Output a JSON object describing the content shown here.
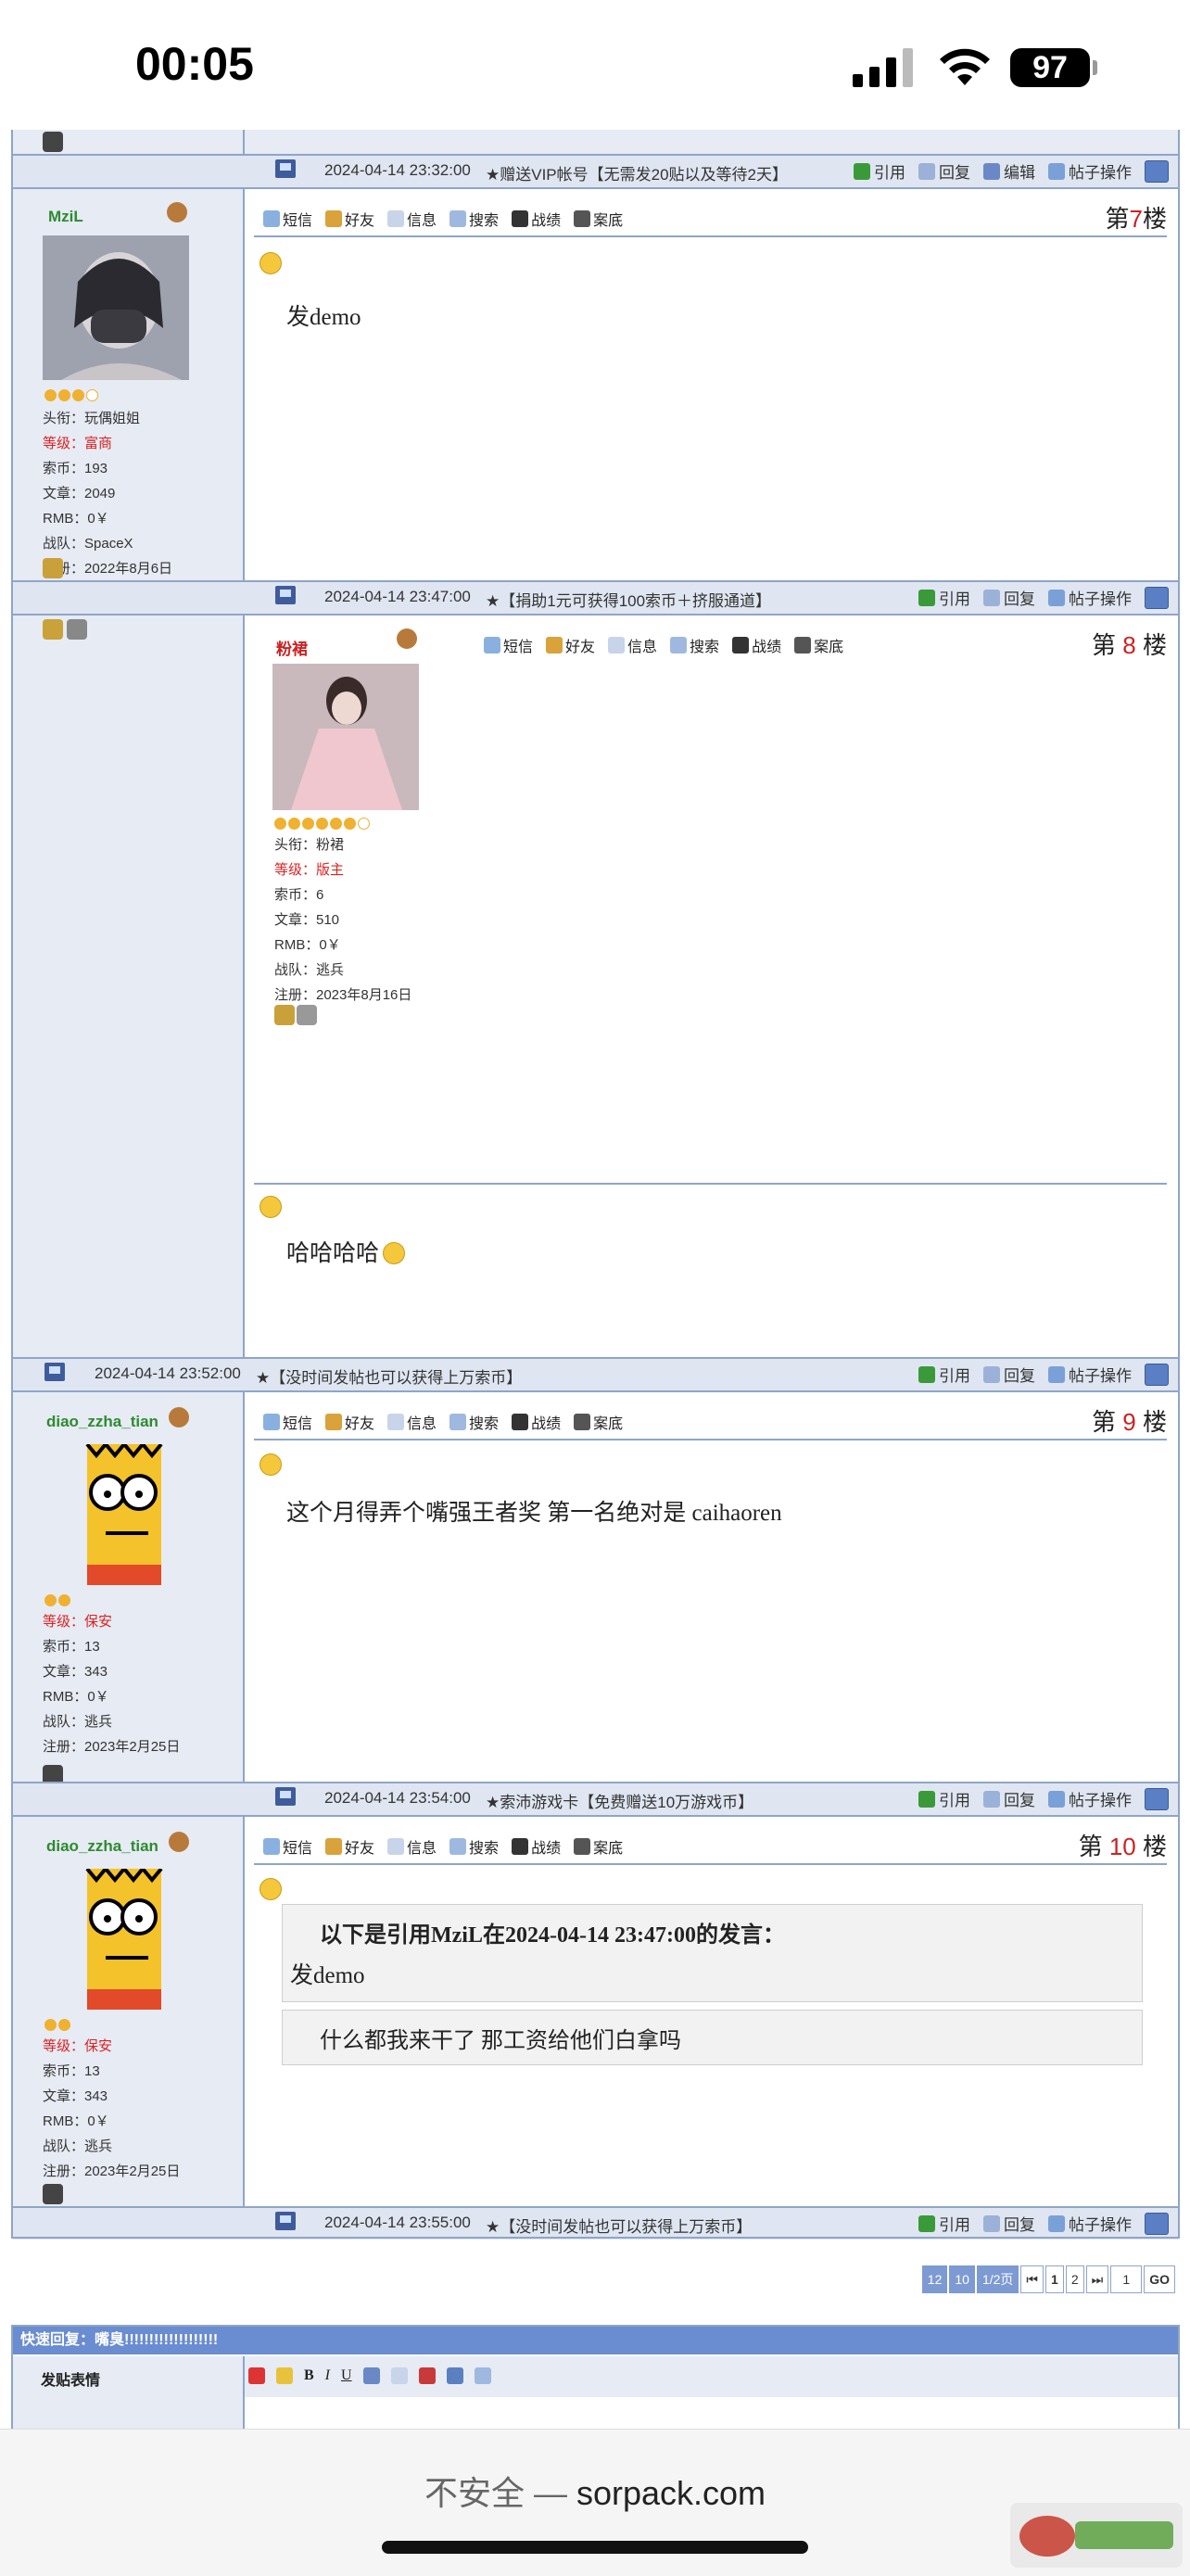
{
  "status": {
    "time": "00:05",
    "battery": "97"
  },
  "ui": {
    "top_bar_date": "2024-04-14 23:32:00",
    "top_bar_ann": "★赠送VIP帐号【无需发20贴以及等待2天】",
    "acts": {
      "quote": "引用",
      "reply": "回复",
      "edit": "编辑",
      "op": "帖子操作"
    },
    "toolbar": {
      "sms": "短信",
      "friend": "好友",
      "info": "信息",
      "search": "搜索",
      "record": "战绩",
      "case": "案底"
    },
    "floor_prefix": "第",
    "floor_suffix": "楼"
  },
  "posts": [
    {
      "floor": "7",
      "user": "MziL",
      "title": "头衔：玩偶姐姐",
      "level": "等级：富商",
      "coins": "索币：193",
      "articles": "文章：2049",
      "rmb": "RMB：0￥",
      "team": "战队：SpaceX",
      "reg": "注册：2022年8月6日",
      "msg": "发demo",
      "bar_date": "2024-04-14 23:47:00",
      "bar_ann": "★【捐助1元可获得100索币＋挤服通道】"
    },
    {
      "floor": "8",
      "user": "粉裙",
      "title": "头衔：粉裙",
      "level": "等级：版主",
      "coins": "索币：6",
      "articles": "文章：510",
      "rmb": "RMB：0￥",
      "team": "战队：逃兵",
      "reg": "注册：2023年8月16日",
      "msg": "哈哈哈哈",
      "bar_date": "2024-04-14 23:52:00",
      "bar_ann": "★【没时间发帖也可以获得上万索币】"
    },
    {
      "floor": "9",
      "user": "diao_zzha_tian",
      "level": "等级：保安",
      "coins": "索币：13",
      "articles": "文章：343",
      "rmb": "RMB：0￥",
      "team": "战队：逃兵",
      "reg": "注册：2023年2月25日",
      "msg": "这个月得弄个嘴强王者奖 第一名绝对是 caihaoren",
      "bar_date": "2024-04-14 23:54:00",
      "bar_ann": "★索沛游戏卡【免费赠送10万游戏币】"
    },
    {
      "floor": "10",
      "user": "diao_zzha_tian",
      "level": "等级：保安",
      "coins": "索币：13",
      "articles": "文章：343",
      "rmb": "RMB：0￥",
      "team": "战队：逃兵",
      "reg": "注册：2023年2月25日",
      "quote_head": "以下是引用MziL在2024-04-14 23:47:00的发言：",
      "quote_body": "发demo",
      "msg": "什么都我来干了 那工资给他们白拿吗",
      "bar_date": "2024-04-14 23:55:00",
      "bar_ann": "★【没时间发帖也可以获得上万索币】"
    }
  ],
  "pager": {
    "a": "12",
    "b": "10",
    "c": "1/2页",
    "first": "⏮",
    "p1": "1",
    "p2": "2",
    "last": "⏭",
    "input": "1",
    "go": "GO"
  },
  "quick": {
    "head": "快速回复：嘴臭!!!!!!!!!!!!!!!!!!!",
    "label": "发贴表情"
  },
  "browser": {
    "insecure": "不安全 —",
    "domain": "sorpack.com"
  }
}
